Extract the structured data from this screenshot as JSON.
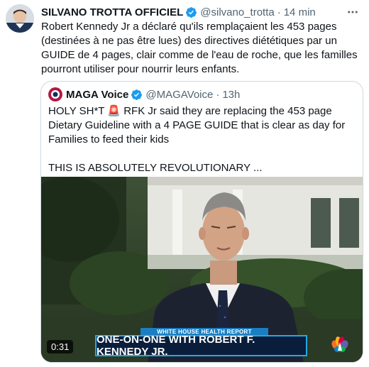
{
  "tweet": {
    "author_name": "SILVANO TROTTA OFFICIEL",
    "handle": "@silvano_trotta",
    "separator": "·",
    "time": "14 min",
    "text": "Robert Kennedy Jr a déclaré qu'ils remplaçaient les 453 pages (destinées à ne pas être lues) des directives diététiques par un GUIDE de 4 pages, clair comme de l'eau de roche, que les familles pourront utiliser pour nourrir leurs enfants."
  },
  "quote": {
    "author_name": "MAGA Voice",
    "handle": "@MAGAVoice",
    "separator": "·",
    "time": "13h",
    "text_line1": "HOLY SH*T 🚨 RFK Jr said they are replacing the 453 page Dietary Guideline with a 4 PAGE GUIDE that is clear as day for Families to feed their kids",
    "text_line2": "THIS IS ABSOLUTELY REVOLUTIONARY ..."
  },
  "video": {
    "duration": "0:31",
    "banner_small": "WHITE HOUSE HEALTH REPORT",
    "banner_main": "ONE-ON-ONE WITH ROBERT F. KENNEDY JR."
  },
  "colors": {
    "verified_badge": "#1d9bf0",
    "secondary_text": "#536471",
    "border": "#cfd9de",
    "banner_blue": "#28a8e0"
  },
  "icons": [
    "verified-badge-icon",
    "more-options-icon",
    "siren-emoji",
    "network-logo-icon"
  ]
}
